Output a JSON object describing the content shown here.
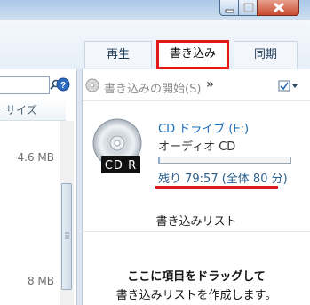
{
  "tabs": {
    "play": "再生",
    "burn": "書き込み",
    "sync": "同期"
  },
  "left": {
    "column_header": "サイズ",
    "sizes": [
      "4.6 MB",
      "8 MB"
    ]
  },
  "burn": {
    "start_label": "書き込みの開始(S)",
    "more": "»",
    "drive_name": "CD ドライブ (E:)",
    "disc_type": "オーディオ CD",
    "disc_label": "CD R",
    "remaining": "残り 79:57 (全体 80 分)",
    "capacity_used_fraction": 0.01,
    "list_title": "書き込みリスト",
    "hint_line1": "ここに項目をドラッグして",
    "hint_line2": "書き込みリストを作成します。"
  },
  "colors": {
    "highlight": "#e31818",
    "link": "#1f6fb8"
  }
}
